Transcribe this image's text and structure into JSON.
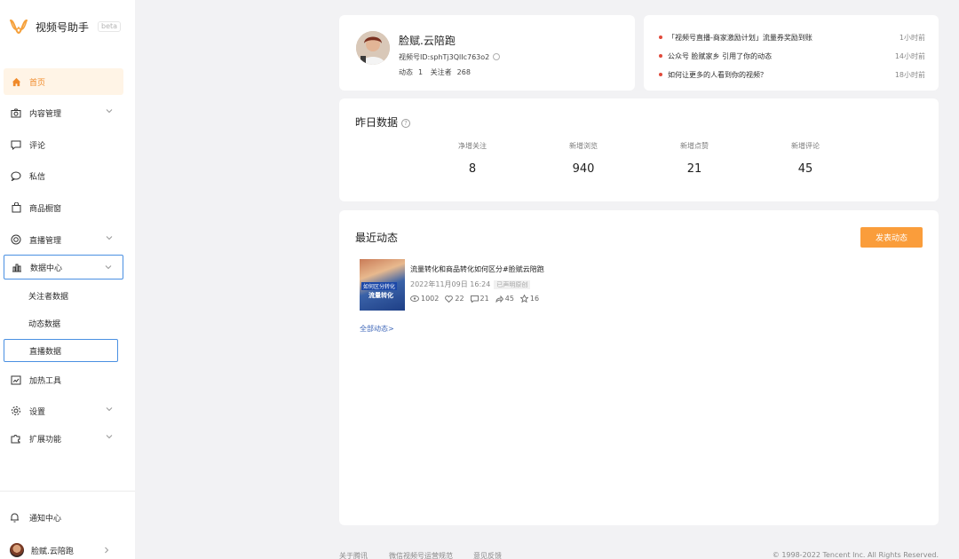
{
  "app": {
    "name": "视频号助手",
    "badge": "beta"
  },
  "sidebar": {
    "items": [
      {
        "label": "首页",
        "icon": "home-icon"
      },
      {
        "label": "内容管理",
        "icon": "camera-icon"
      },
      {
        "label": "评论",
        "icon": "comment-icon"
      },
      {
        "label": "私信",
        "icon": "message-icon"
      },
      {
        "label": "商品橱窗",
        "icon": "bag-icon"
      },
      {
        "label": "直播管理",
        "icon": "live-icon"
      },
      {
        "label": "数据中心",
        "icon": "chart-icon"
      },
      {
        "label": "加热工具",
        "icon": "trend-icon"
      },
      {
        "label": "设置",
        "icon": "gear-icon"
      },
      {
        "label": "扩展功能",
        "icon": "puzzle-icon"
      }
    ],
    "sub_items": [
      "关注者数据",
      "动态数据",
      "直播数据"
    ],
    "bottom": {
      "notify": "通知中心",
      "user": "脸赋.云陪跑"
    },
    "accent_color": "#f08a2a",
    "highlight_color": "#4a90e2"
  },
  "profile": {
    "name": "脸赋.云陪跑",
    "id_text": "视频号ID:sphTj3QlIc763o2",
    "posts_label": "动态",
    "posts": "1",
    "followers_label": "关注者",
    "followers": "268"
  },
  "notices": [
    {
      "text": "「视频号直播-商家激励计划」流量券奖励到账",
      "time": "1小时前"
    },
    {
      "text": "公众号 脸赋家乡 引用了你的动态",
      "time": "14小时前"
    },
    {
      "text": "如何让更多的人看到你的视频？",
      "time": "18小时前"
    }
  ],
  "yesterday": {
    "title": "昨日数据",
    "stats": [
      {
        "label": "净增关注",
        "value": "8"
      },
      {
        "label": "新增浏览",
        "value": "940"
      },
      {
        "label": "新增点赞",
        "value": "21"
      },
      {
        "label": "新增评论",
        "value": "45"
      }
    ]
  },
  "feed": {
    "title": "最近动态",
    "publish_label": "发表动态",
    "post": {
      "title": "流量转化和商品转化如何区分#脸赋云陪跑",
      "date": "2022年11月09日 16:24",
      "badge": "已声明原创",
      "thumb_text_1": "如何区分转化",
      "thumb_text_2": "流量转化",
      "views": "1002",
      "likes": "22",
      "comments": "21",
      "shares": "45",
      "favorites": "16"
    },
    "all_link": "全部动态>"
  },
  "footer": {
    "links": [
      "关于腾讯",
      "微信视频号运营规范",
      "意见反馈"
    ],
    "copyright": "© 1998-2022 Tencent Inc. All Rights Reserved."
  }
}
